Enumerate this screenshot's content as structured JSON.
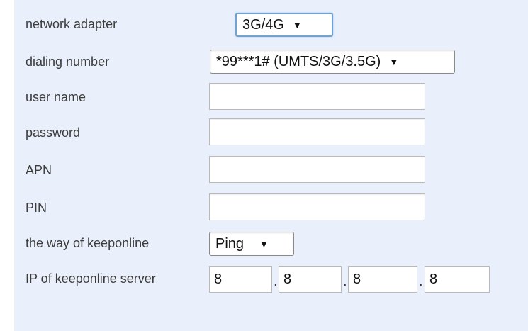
{
  "form": {
    "network_adapter": {
      "label": "network adapter",
      "selected": "3G/4G"
    },
    "dialing_number": {
      "label": "dialing number",
      "selected": "*99***1# (UMTS/3G/3.5G)"
    },
    "user_name": {
      "label": "user name",
      "value": ""
    },
    "password": {
      "label": "password",
      "value": ""
    },
    "apn": {
      "label": "APN",
      "value": ""
    },
    "pin": {
      "label": "PIN",
      "value": ""
    },
    "keeponline_way": {
      "label": "the way of keeponline",
      "selected": "Ping"
    },
    "keeponline_server": {
      "label": "IP of keeponline server",
      "octets": [
        "8",
        "8",
        "8",
        "8"
      ],
      "separator": "."
    }
  },
  "icons": {
    "dropdown_arrow": "▼"
  },
  "colors": {
    "panel_background": "#eaf0fb",
    "focus_border": "#6fa3d6",
    "label_text": "#3c3c3c"
  }
}
